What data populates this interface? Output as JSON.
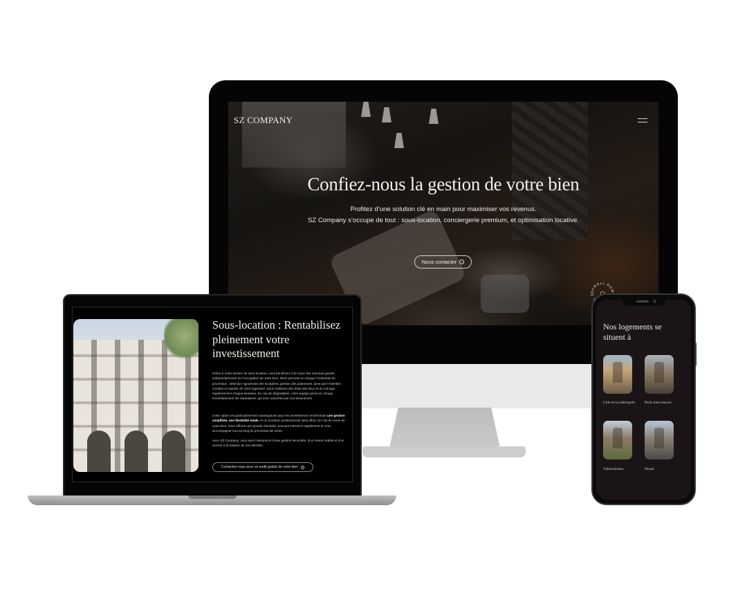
{
  "desktop": {
    "brand": "SZ COMPANY",
    "hero_title": "Confiez-nous la gestion de votre bien",
    "hero_line1": "Profitez d’une solution clé en main pour maximiser vos revenus.",
    "hero_line2": "SZ Company s’occupe de tout : sous-location, conciergerie premium, et optimisation locative.",
    "cta_label": "Nous contacter",
    "scroll_badge": "SCROLL DOWN · SCROLL DOWN · "
  },
  "laptop": {
    "title": "Sous-location : Rentabilisez pleinement votre investissement",
    "para1": "Grâce à notre service de sous-location, vous bénéficiez d’un loyer fixe mensuel garanti, indépendamment de l’occupation de votre bien. Nous prenons en charge l’ensemble du processus : sélection rigoureuse des locataires, gestion des paiements, ainsi que l’entretien complet et régulier de votre logement. Nous réalisons des états des lieux et du ménage régulièrement chaque semaine. En cas de dégradation, notre équipe prend en charge immédiatement les réparations, qui sont couvertes par nos assurances.",
    "para2_a": "Cette option est particulièrement avantageuse pour les investisseurs recherchant ",
    "para2_bold": "une gestion simplifiée, une flexibilité totale",
    "para2_b": ", et un entretien professionnel sans effort. En cas de vente de votre bien, nous offrons une grande réactivité, pouvant intervenir rapidement et vous accompagner tout au long du processus de vente.",
    "para3": "Avec SZ Company, vous avez l’assurance d’une gestion sécurisée, d’un revenu stable et d’un service à la hauteur de vos attentes.",
    "cta_label": "Contactez-nous pour un audit gratuit de votre bien"
  },
  "phone": {
    "title": "Nos logements se situent à",
    "cities": [
      {
        "label": "Lille et sa métropole"
      },
      {
        "label": "Paris intra-muros"
      },
      {
        "label": "Valenciennes"
      },
      {
        "label": "Douai"
      }
    ]
  }
}
